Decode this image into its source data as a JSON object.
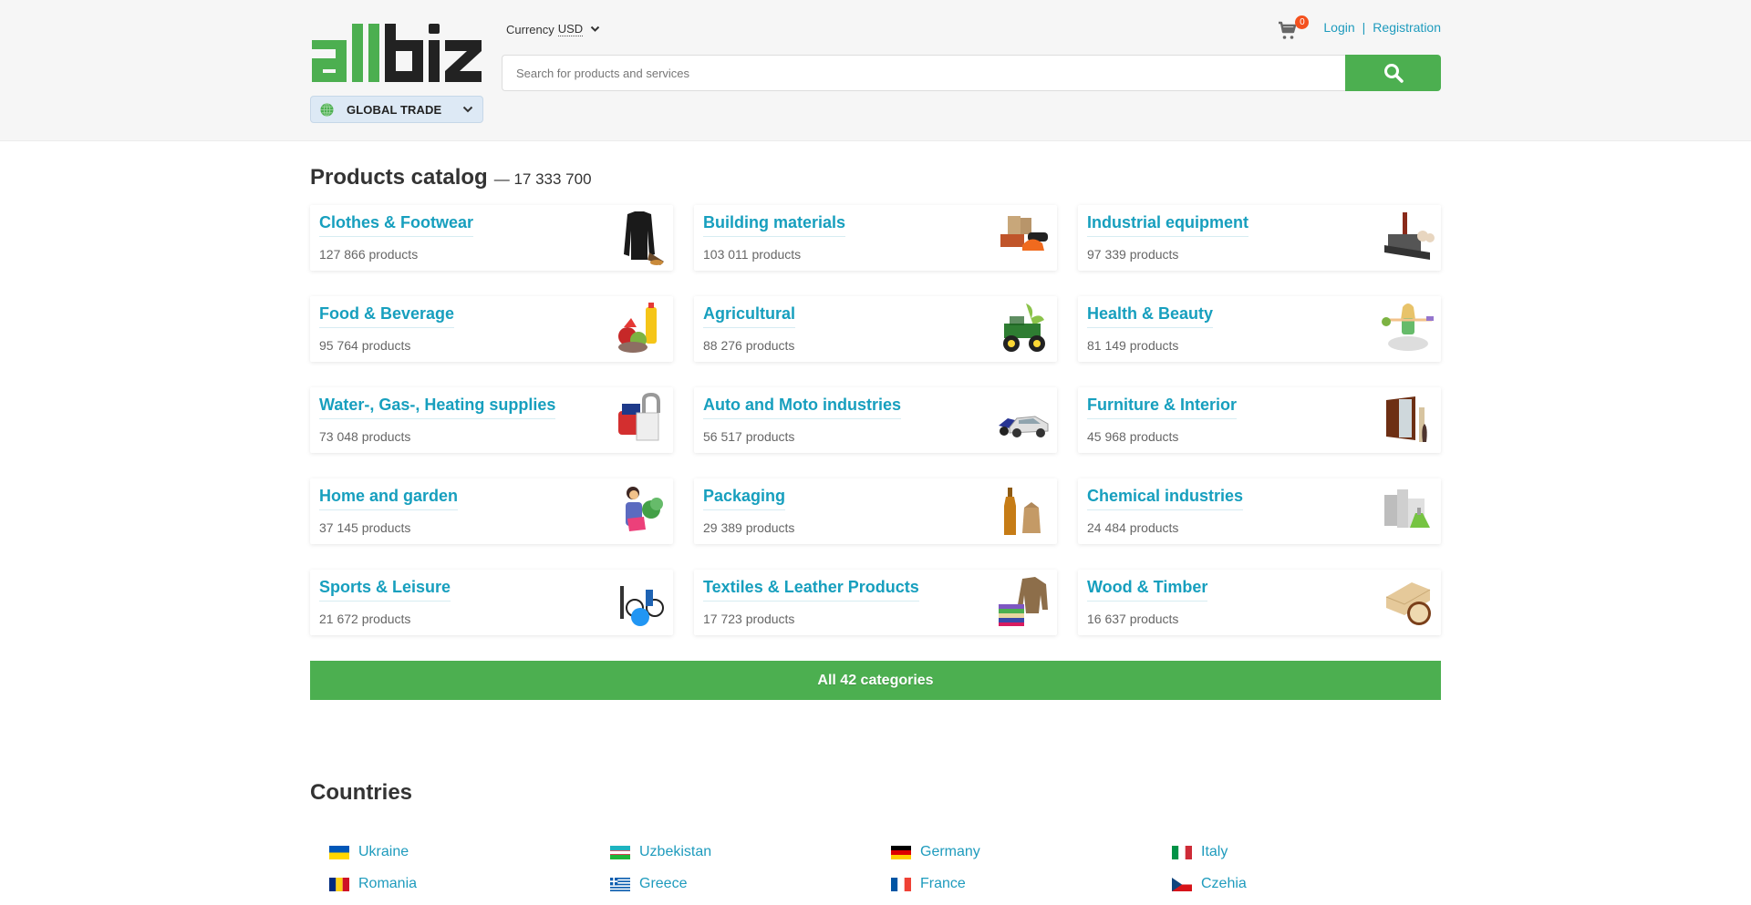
{
  "header": {
    "logo_text": "allbiz",
    "region_label": "GLOBAL TRADE",
    "currency_label": "Currency",
    "currency_value": "USD",
    "search_placeholder": "Search for products and services",
    "search_value": "",
    "cart_count": "0",
    "login_label": "Login",
    "separator": "|",
    "registration_label": "Registration"
  },
  "colors": {
    "brand_green": "#4caf50",
    "link_blue": "#179fbe",
    "badge_orange": "#f4511e",
    "header_bg": "#f6f6f6"
  },
  "catalog": {
    "title": "Products catalog",
    "total": "— 17 333 700",
    "categories": [
      {
        "name": "Clothes & Footwear",
        "count": "127 866 products",
        "icon": "clothes-icon"
      },
      {
        "name": "Building materials",
        "count": "103 011 products",
        "icon": "building-materials-icon"
      },
      {
        "name": "Industrial equipment",
        "count": "97 339 products",
        "icon": "factory-icon"
      },
      {
        "name": "Food & Beverage",
        "count": "95 764 products",
        "icon": "food-icon"
      },
      {
        "name": "Agricultural",
        "count": "88 276 products",
        "icon": "tractor-icon"
      },
      {
        "name": "Health & Beauty",
        "count": "81 149 products",
        "icon": "health-icon"
      },
      {
        "name": "Water-, Gas-, Heating supplies",
        "count": "73 048 products",
        "icon": "boiler-icon"
      },
      {
        "name": "Auto and Moto industries",
        "count": "56 517 products",
        "icon": "car-icon"
      },
      {
        "name": "Furniture & Interior",
        "count": "45 968 products",
        "icon": "wardrobe-icon"
      },
      {
        "name": "Home and garden",
        "count": "37 145 products",
        "icon": "garden-icon"
      },
      {
        "name": "Packaging",
        "count": "29 389 products",
        "icon": "packaging-icon"
      },
      {
        "name": "Chemical industries",
        "count": "24 484 products",
        "icon": "chemical-icon"
      },
      {
        "name": "Sports & Leisure",
        "count": "21 672 products",
        "icon": "sports-icon"
      },
      {
        "name": "Textiles & Leather Products",
        "count": "17 723 products",
        "icon": "textiles-icon"
      },
      {
        "name": "Wood & Timber",
        "count": "16 637 products",
        "icon": "wood-icon"
      }
    ],
    "all_button_label": "All 42 categories"
  },
  "countries": {
    "title": "Countries",
    "items": [
      {
        "name": "Ukraine",
        "flag": "ukraine"
      },
      {
        "name": "Uzbekistan",
        "flag": "uzbekistan"
      },
      {
        "name": "Germany",
        "flag": "germany"
      },
      {
        "name": "Italy",
        "flag": "italy"
      },
      {
        "name": "Romania",
        "flag": "romania"
      },
      {
        "name": "Greece",
        "flag": "greece"
      },
      {
        "name": "France",
        "flag": "france"
      },
      {
        "name": "Czehia",
        "flag": "czechia"
      }
    ]
  }
}
